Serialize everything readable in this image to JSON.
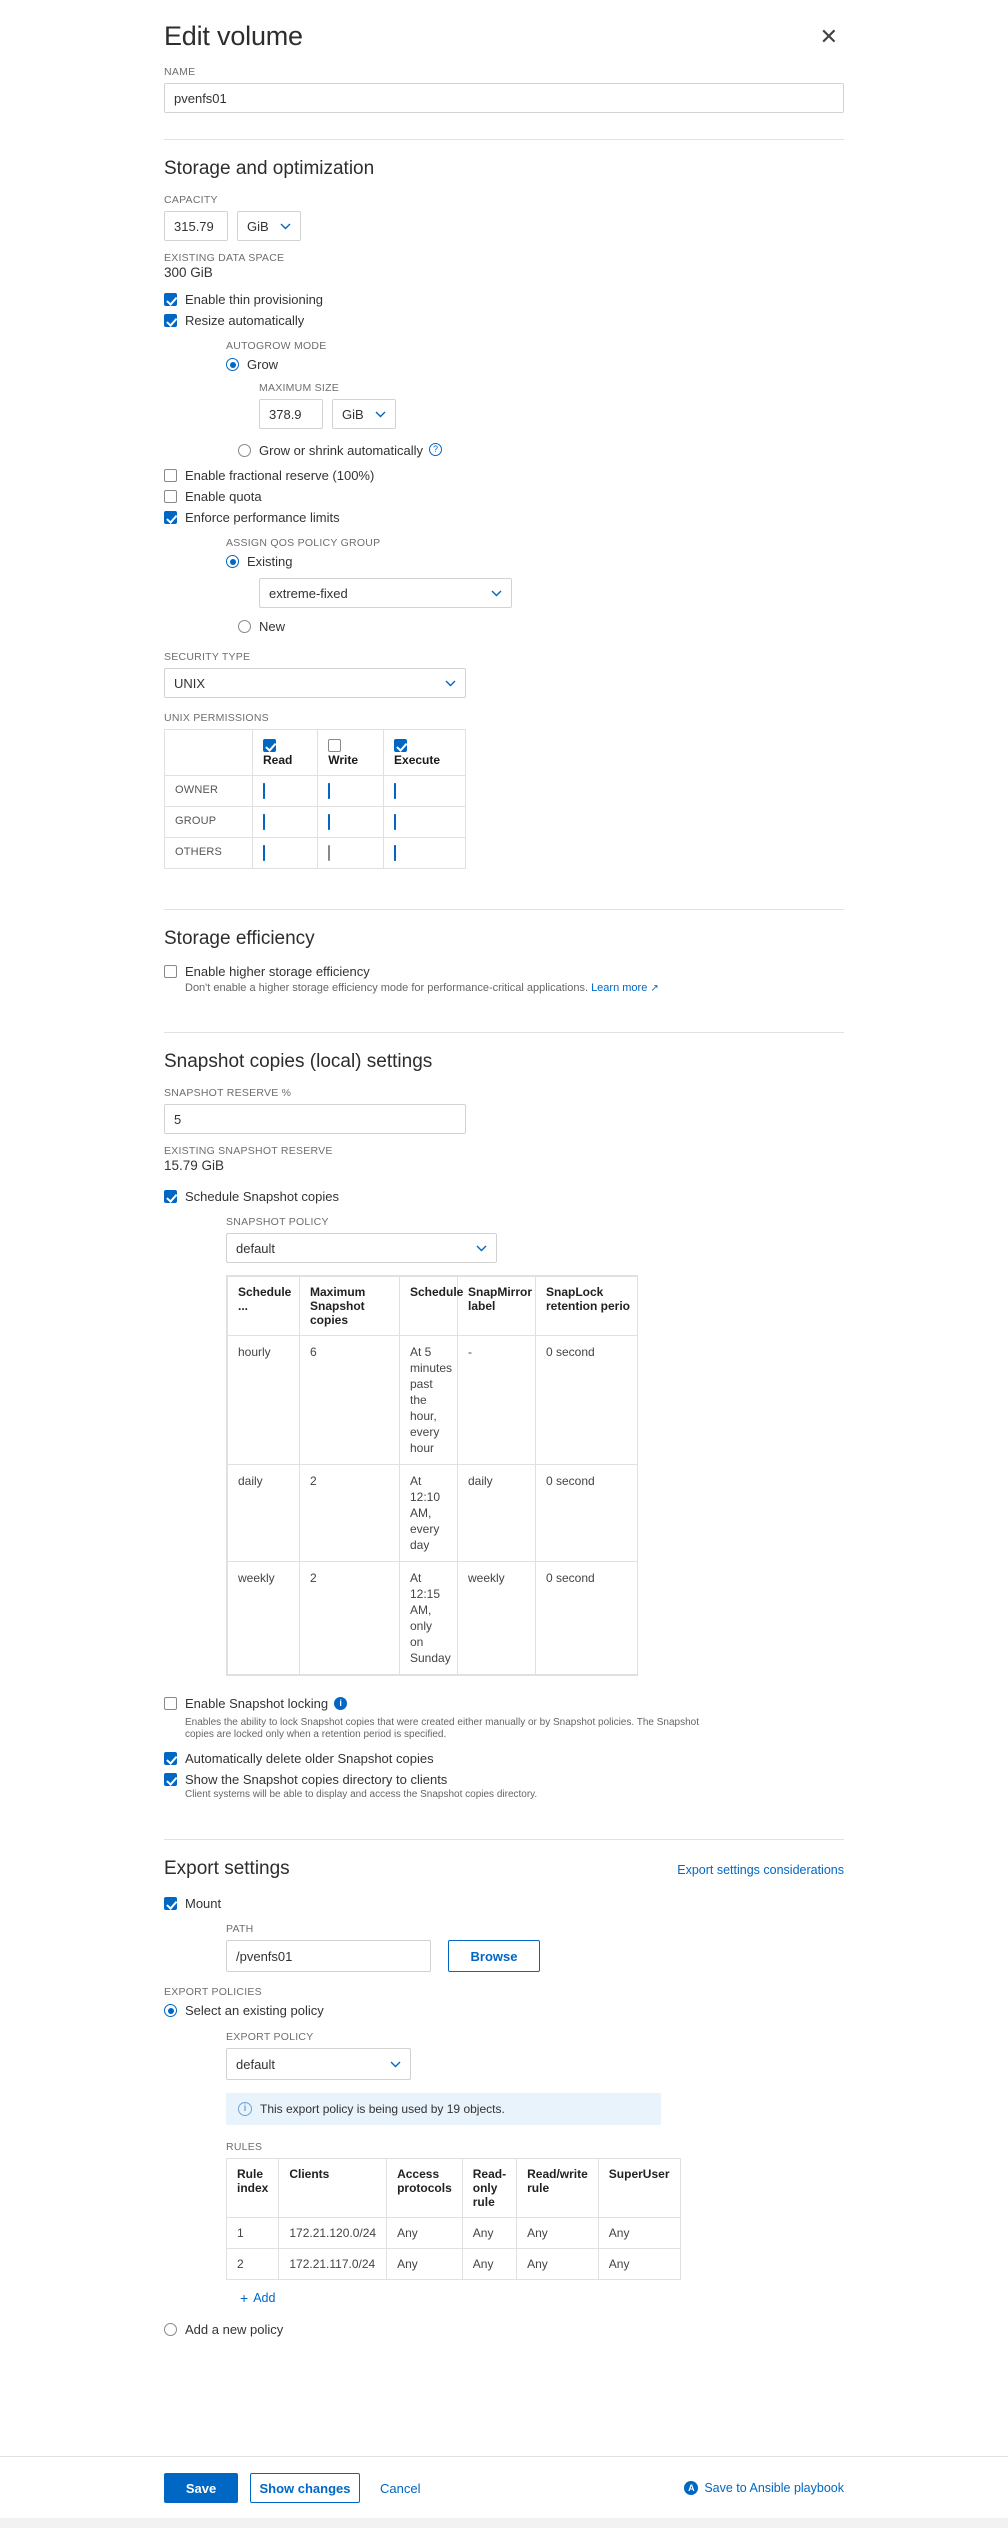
{
  "dialog": {
    "title": "Edit volume",
    "close_icon": "close-icon"
  },
  "name_field": {
    "label": "NAME",
    "value": "pvenfs01"
  },
  "storage": {
    "heading": "Storage and optimization",
    "capacity_label": "CAPACITY",
    "capacity_value": "315.79",
    "capacity_unit": "GiB",
    "existing_data_space_label": "EXISTING DATA SPACE",
    "existing_data_space_value": "300 GiB",
    "thin_provisioning": "Enable thin provisioning",
    "resize_automatically": "Resize automatically",
    "autogrow_mode_label": "AUTOGROW MODE",
    "grow": "Grow",
    "maximum_size_label": "MAXIMUM SIZE",
    "maximum_size_value": "378.9",
    "maximum_size_unit": "GiB",
    "grow_or_shrink": "Grow or shrink automatically",
    "fractional_reserve": "Enable fractional reserve (100%)",
    "enable_quota": "Enable quota",
    "enforce_performance_limits": "Enforce performance limits",
    "assign_qos_label": "ASSIGN QOS POLICY GROUP",
    "qos_existing": "Existing",
    "qos_policy_value": "extreme-fixed",
    "qos_new": "New",
    "security_type_label": "SECURITY TYPE",
    "security_type_value": "UNIX",
    "unix_permissions_label": "UNIX PERMISSIONS"
  },
  "unix_permissions": {
    "columns": [
      {
        "label": "Read",
        "checked": true
      },
      {
        "label": "Write",
        "checked": false
      },
      {
        "label": "Execute",
        "checked": true
      }
    ],
    "rows": [
      {
        "name": "OWNER",
        "read": true,
        "write": true,
        "execute": true
      },
      {
        "name": "GROUP",
        "read": true,
        "write": true,
        "execute": true
      },
      {
        "name": "OTHERS",
        "read": true,
        "write": false,
        "execute": true
      }
    ]
  },
  "storage_efficiency": {
    "heading": "Storage efficiency",
    "checkbox_label": "Enable higher storage efficiency",
    "description": "Don't enable a higher storage efficiency mode for performance-critical applications.",
    "learn_more": "Learn more"
  },
  "snapshot": {
    "heading": "Snapshot copies (local) settings",
    "reserve_label": "SNAPSHOT RESERVE %",
    "reserve_value": "5",
    "existing_reserve_label": "EXISTING SNAPSHOT RESERVE",
    "existing_reserve_value": "15.79 GiB",
    "schedule_checkbox": "Schedule Snapshot copies",
    "policy_label": "SNAPSHOT POLICY",
    "policy_value": "default",
    "table": {
      "headers": [
        "Schedule ...",
        "Maximum Snapshot copies",
        "Schedule",
        "SnapMirror label",
        "SnapLock retention perio"
      ],
      "rows": [
        {
          "schedule_name": "hourly",
          "max_copies": "6",
          "schedule": "At 5 minutes past the hour, every hour",
          "snapmirror_label": "-",
          "snaplock": "0 second"
        },
        {
          "schedule_name": "daily",
          "max_copies": "2",
          "schedule": "At 12:10 AM, every day",
          "snapmirror_label": "daily",
          "snaplock": "0 second"
        },
        {
          "schedule_name": "weekly",
          "max_copies": "2",
          "schedule": "At 12:15 AM, only on Sunday",
          "snapmirror_label": "weekly",
          "snaplock": "0 second"
        }
      ]
    },
    "locking_label": "Enable Snapshot locking",
    "locking_desc": "Enables the ability to lock Snapshot copies that were created either manually or by Snapshot policies. The Snapshot copies are locked only when a retention period is specified.",
    "auto_delete": "Automatically delete older Snapshot copies",
    "show_dir": "Show the Snapshot copies directory to clients",
    "show_dir_desc": "Client systems will be able to display and access the Snapshot copies directory."
  },
  "export": {
    "heading": "Export settings",
    "considerations_link": "Export settings considerations",
    "mount_label": "Mount",
    "path_label": "PATH",
    "path_value": "/pvenfs01",
    "browse_label": "Browse",
    "export_policies_label": "EXPORT POLICIES",
    "select_existing": "Select an existing policy",
    "export_policy_label": "EXPORT POLICY",
    "export_policy_value": "default",
    "info_message": "This export policy is being used by 19 objects.",
    "rules_label": "RULES",
    "rules_headers": [
      "Rule index",
      "Clients",
      "Access protocols",
      "Read-only rule",
      "Read/write rule",
      "SuperUser"
    ],
    "rules_rows": [
      {
        "index": "1",
        "clients": "172.21.120.0/24",
        "access": "Any",
        "ro": "Any",
        "rw": "Any",
        "superuser": "Any"
      },
      {
        "index": "2",
        "clients": "172.21.117.0/24",
        "access": "Any",
        "ro": "Any",
        "rw": "Any",
        "superuser": "Any"
      }
    ],
    "add_label": "Add",
    "add_new_policy": "Add a new policy"
  },
  "footer": {
    "save": "Save",
    "show_changes": "Show changes",
    "cancel": "Cancel",
    "ansible": "Save to Ansible playbook"
  },
  "colors": {
    "accent": "#0067c5",
    "info_bg": "#e9f3fb",
    "border": "#e0e0e0"
  }
}
